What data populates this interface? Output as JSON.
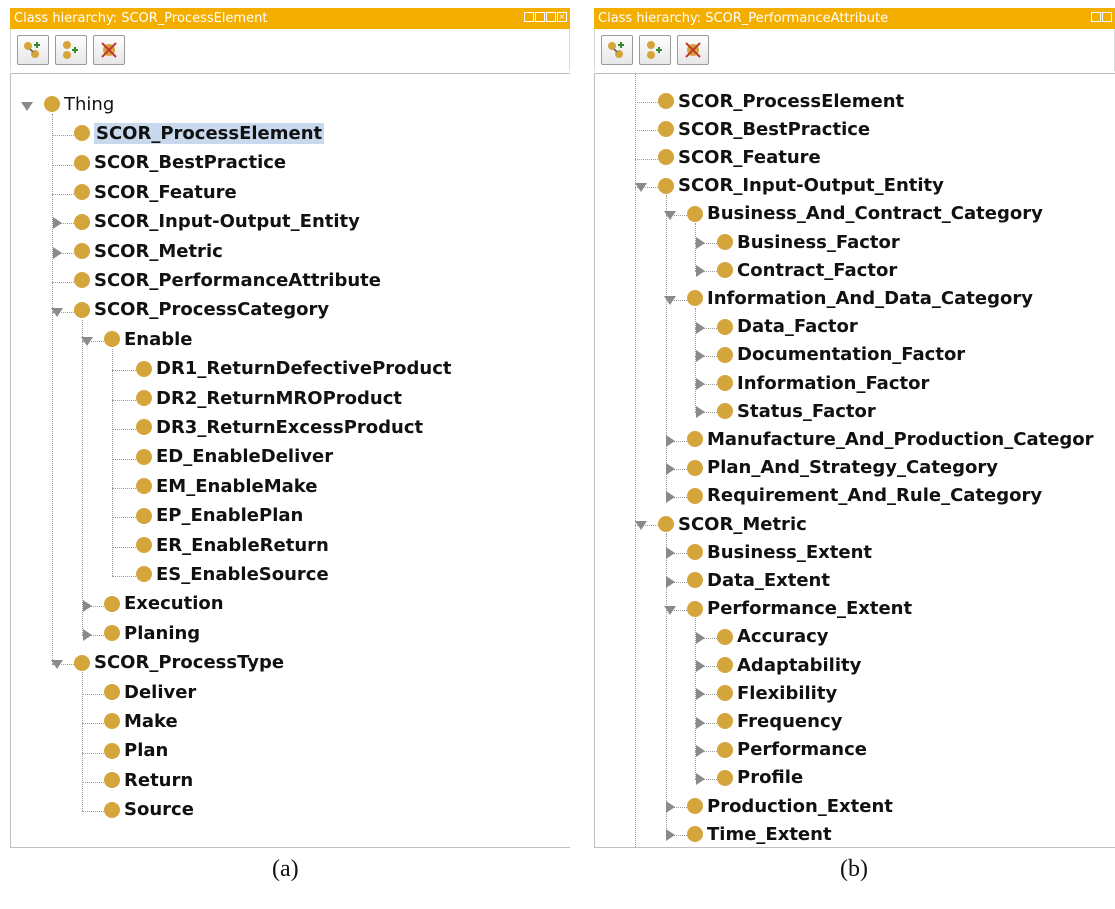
{
  "panel_a": {
    "title": "Class hierarchy: SCOR_ProcessElement",
    "caption": "(a)",
    "tree": [
      {
        "label": "Thing",
        "level": 0,
        "state": "exp",
        "plain": true
      },
      {
        "label": "SCOR_ProcessElement",
        "level": 1,
        "state": "leaf",
        "selected": true
      },
      {
        "label": "SCOR_BestPractice",
        "level": 1,
        "state": "leaf"
      },
      {
        "label": "SCOR_Feature",
        "level": 1,
        "state": "leaf"
      },
      {
        "label": "SCOR_Input-Output_Entity",
        "level": 1,
        "state": "col"
      },
      {
        "label": "SCOR_Metric",
        "level": 1,
        "state": "col"
      },
      {
        "label": "SCOR_PerformanceAttribute",
        "level": 1,
        "state": "leaf"
      },
      {
        "label": "SCOR_ProcessCategory",
        "level": 1,
        "state": "exp"
      },
      {
        "label": "Enable",
        "level": 2,
        "state": "exp"
      },
      {
        "label": "DR1_ReturnDefectiveProduct",
        "level": 3,
        "state": "leaf"
      },
      {
        "label": "DR2_ReturnMROProduct",
        "level": 3,
        "state": "leaf"
      },
      {
        "label": "DR3_ReturnExcessProduct",
        "level": 3,
        "state": "leaf"
      },
      {
        "label": "ED_EnableDeliver",
        "level": 3,
        "state": "leaf"
      },
      {
        "label": "EM_EnableMake",
        "level": 3,
        "state": "leaf"
      },
      {
        "label": "EP_EnablePlan",
        "level": 3,
        "state": "leaf"
      },
      {
        "label": "ER_EnableReturn",
        "level": 3,
        "state": "leaf"
      },
      {
        "label": "ES_EnableSource",
        "level": 3,
        "state": "leaf"
      },
      {
        "label": "Execution",
        "level": 2,
        "state": "col"
      },
      {
        "label": "Planing",
        "level": 2,
        "state": "col"
      },
      {
        "label": "SCOR_ProcessType",
        "level": 1,
        "state": "exp"
      },
      {
        "label": "Deliver",
        "level": 2,
        "state": "leaf"
      },
      {
        "label": "Make",
        "level": 2,
        "state": "leaf"
      },
      {
        "label": "Plan",
        "level": 2,
        "state": "leaf"
      },
      {
        "label": "Return",
        "level": 2,
        "state": "leaf"
      },
      {
        "label": "Source",
        "level": 2,
        "state": "leaf"
      }
    ]
  },
  "panel_b": {
    "title": "Class hierarchy: SCOR_PerformanceAttribute",
    "caption": "(b)",
    "tree": [
      {
        "label": "SCOR_ProcessElement",
        "level": 1,
        "state": "leaf"
      },
      {
        "label": "SCOR_BestPractice",
        "level": 1,
        "state": "leaf"
      },
      {
        "label": "SCOR_Feature",
        "level": 1,
        "state": "leaf"
      },
      {
        "label": "SCOR_Input-Output_Entity",
        "level": 1,
        "state": "exp"
      },
      {
        "label": "Business_And_Contract_Category",
        "level": 2,
        "state": "exp"
      },
      {
        "label": "Business_Factor",
        "level": 3,
        "state": "col"
      },
      {
        "label": "Contract_Factor",
        "level": 3,
        "state": "col"
      },
      {
        "label": "Information_And_Data_Category",
        "level": 2,
        "state": "exp"
      },
      {
        "label": "Data_Factor",
        "level": 3,
        "state": "col"
      },
      {
        "label": "Documentation_Factor",
        "level": 3,
        "state": "col"
      },
      {
        "label": "Information_Factor",
        "level": 3,
        "state": "col"
      },
      {
        "label": "Status_Factor",
        "level": 3,
        "state": "col"
      },
      {
        "label": "Manufacture_And_Production_Categor",
        "level": 2,
        "state": "col"
      },
      {
        "label": "Plan_And_Strategy_Category",
        "level": 2,
        "state": "col"
      },
      {
        "label": "Requirement_And_Rule_Category",
        "level": 2,
        "state": "col"
      },
      {
        "label": "SCOR_Metric",
        "level": 1,
        "state": "exp"
      },
      {
        "label": "Business_Extent",
        "level": 2,
        "state": "col"
      },
      {
        "label": "Data_Extent",
        "level": 2,
        "state": "col"
      },
      {
        "label": "Performance_Extent",
        "level": 2,
        "state": "exp"
      },
      {
        "label": "Accuracy",
        "level": 3,
        "state": "col"
      },
      {
        "label": "Adaptability",
        "level": 3,
        "state": "col"
      },
      {
        "label": "Flexibility",
        "level": 3,
        "state": "col"
      },
      {
        "label": "Frequency",
        "level": 3,
        "state": "col"
      },
      {
        "label": "Performance",
        "level": 3,
        "state": "col"
      },
      {
        "label": "Profile",
        "level": 3,
        "state": "col"
      },
      {
        "label": "Production_Extent",
        "level": 2,
        "state": "col"
      },
      {
        "label": "Time_Extent",
        "level": 2,
        "state": "col"
      }
    ]
  },
  "toolbar_icons": [
    "add-subclass-icon",
    "add-sibling-icon",
    "delete-class-icon"
  ],
  "title_controls": [
    "restore-icon",
    "minimize-icon",
    "maximize-icon",
    "close-icon"
  ],
  "colors": {
    "titlebar": "#f3ae00",
    "class_dot": "#d4a53a",
    "selection": "#c8d9ee"
  }
}
